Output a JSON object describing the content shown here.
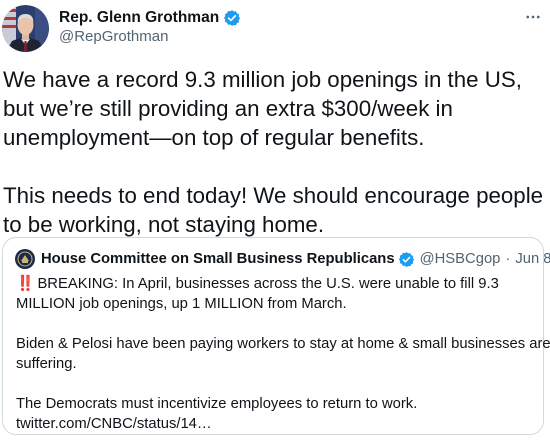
{
  "author": {
    "display_name": "Rep. Glenn Grothman",
    "handle": "@RepGrothman",
    "verified": true,
    "avatar_icon": "portrait-avatar"
  },
  "more_icon": "more-options-icon",
  "tweet": {
    "lines": [
      "We have a record 9.3 million job openings in the US,",
      "but we’re still providing an extra $300/week in",
      "unemployment—on top of regular benefits.",
      "",
      "This needs to end today! We should encourage people",
      "to be working, not staying home."
    ]
  },
  "quoted": {
    "display_name": "House Committee on Small Business Republicans",
    "handle": "@HSBCgop",
    "separator": "·",
    "date": "Jun 8",
    "verified": true,
    "alert_glyph": "‼️",
    "lines": [
      "BREAKING: In April, businesses across the U.S. were unable to fill 9.3",
      "MILLION job openings, up 1 MILLION from March.",
      "",
      "Biden & Pelosi have been paying workers to stay at home & small businesses are",
      "suffering.",
      "",
      "The Democrats must incentivize employees to return to work.",
      "twitter.com/CNBC/status/14…"
    ]
  },
  "colors": {
    "verified_blue": "#1d9bf0",
    "secondary_text": "#536471",
    "border": "#cfd9de",
    "alert_red": "#e0245e"
  }
}
